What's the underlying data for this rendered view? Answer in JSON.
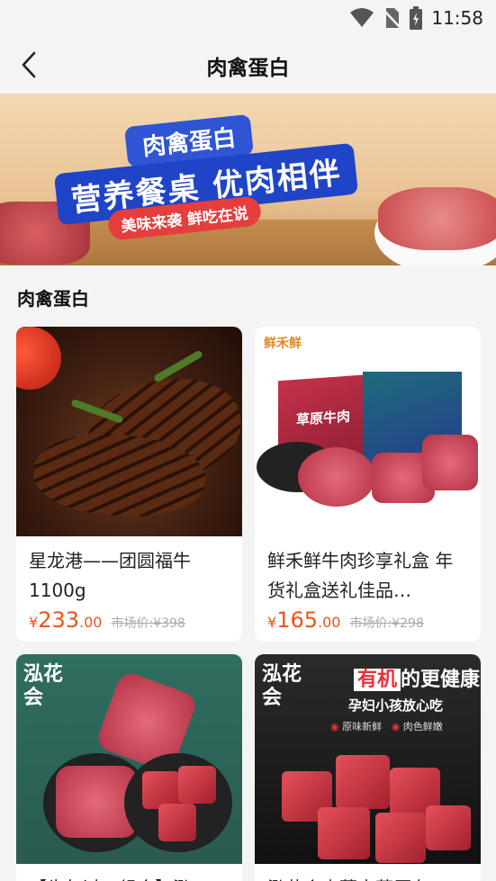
{
  "status_bar": {
    "time": "11:58",
    "icons": [
      "wifi-icon",
      "no-sim-icon",
      "battery-charging-icon"
    ]
  },
  "header": {
    "title": "肉禽蛋白",
    "back_icon": "chevron-left-icon"
  },
  "banner": {
    "title_line1": "肉禽蛋白",
    "title_line2": "营养餐桌 优肉相伴",
    "slogan": "美味来袭 鲜吃在说"
  },
  "section": {
    "title": "肉禽蛋白"
  },
  "products": [
    {
      "name": "星龙港——团圆福牛1100g",
      "currency": "¥",
      "price_int": "233",
      "price_dec": ".00",
      "market_price": "市场价:¥398"
    },
    {
      "name": "鲜禾鲜牛肉珍享礼盒 年货礼盒送礼佳品…",
      "currency": "¥",
      "price_int": "165",
      "price_dec": ".00",
      "market_price": "市场价:¥298",
      "image_brand": "鲜禾鲜",
      "box_label": "草原牛肉"
    },
    {
      "name": "【牛年过五组合】泓",
      "image_brand": "泓花会"
    },
    {
      "name": "泓花会内蒙古草原有",
      "image_brand": "泓花会",
      "image_headline_a": "有机",
      "image_headline_b": "的更健康",
      "image_sub": "孕妇小孩放心吃",
      "image_tag1": "原味新鲜",
      "image_tag2": "肉色鲜嫩"
    }
  ],
  "colors": {
    "price": "#ec5418",
    "background": "#f4f4f4"
  }
}
